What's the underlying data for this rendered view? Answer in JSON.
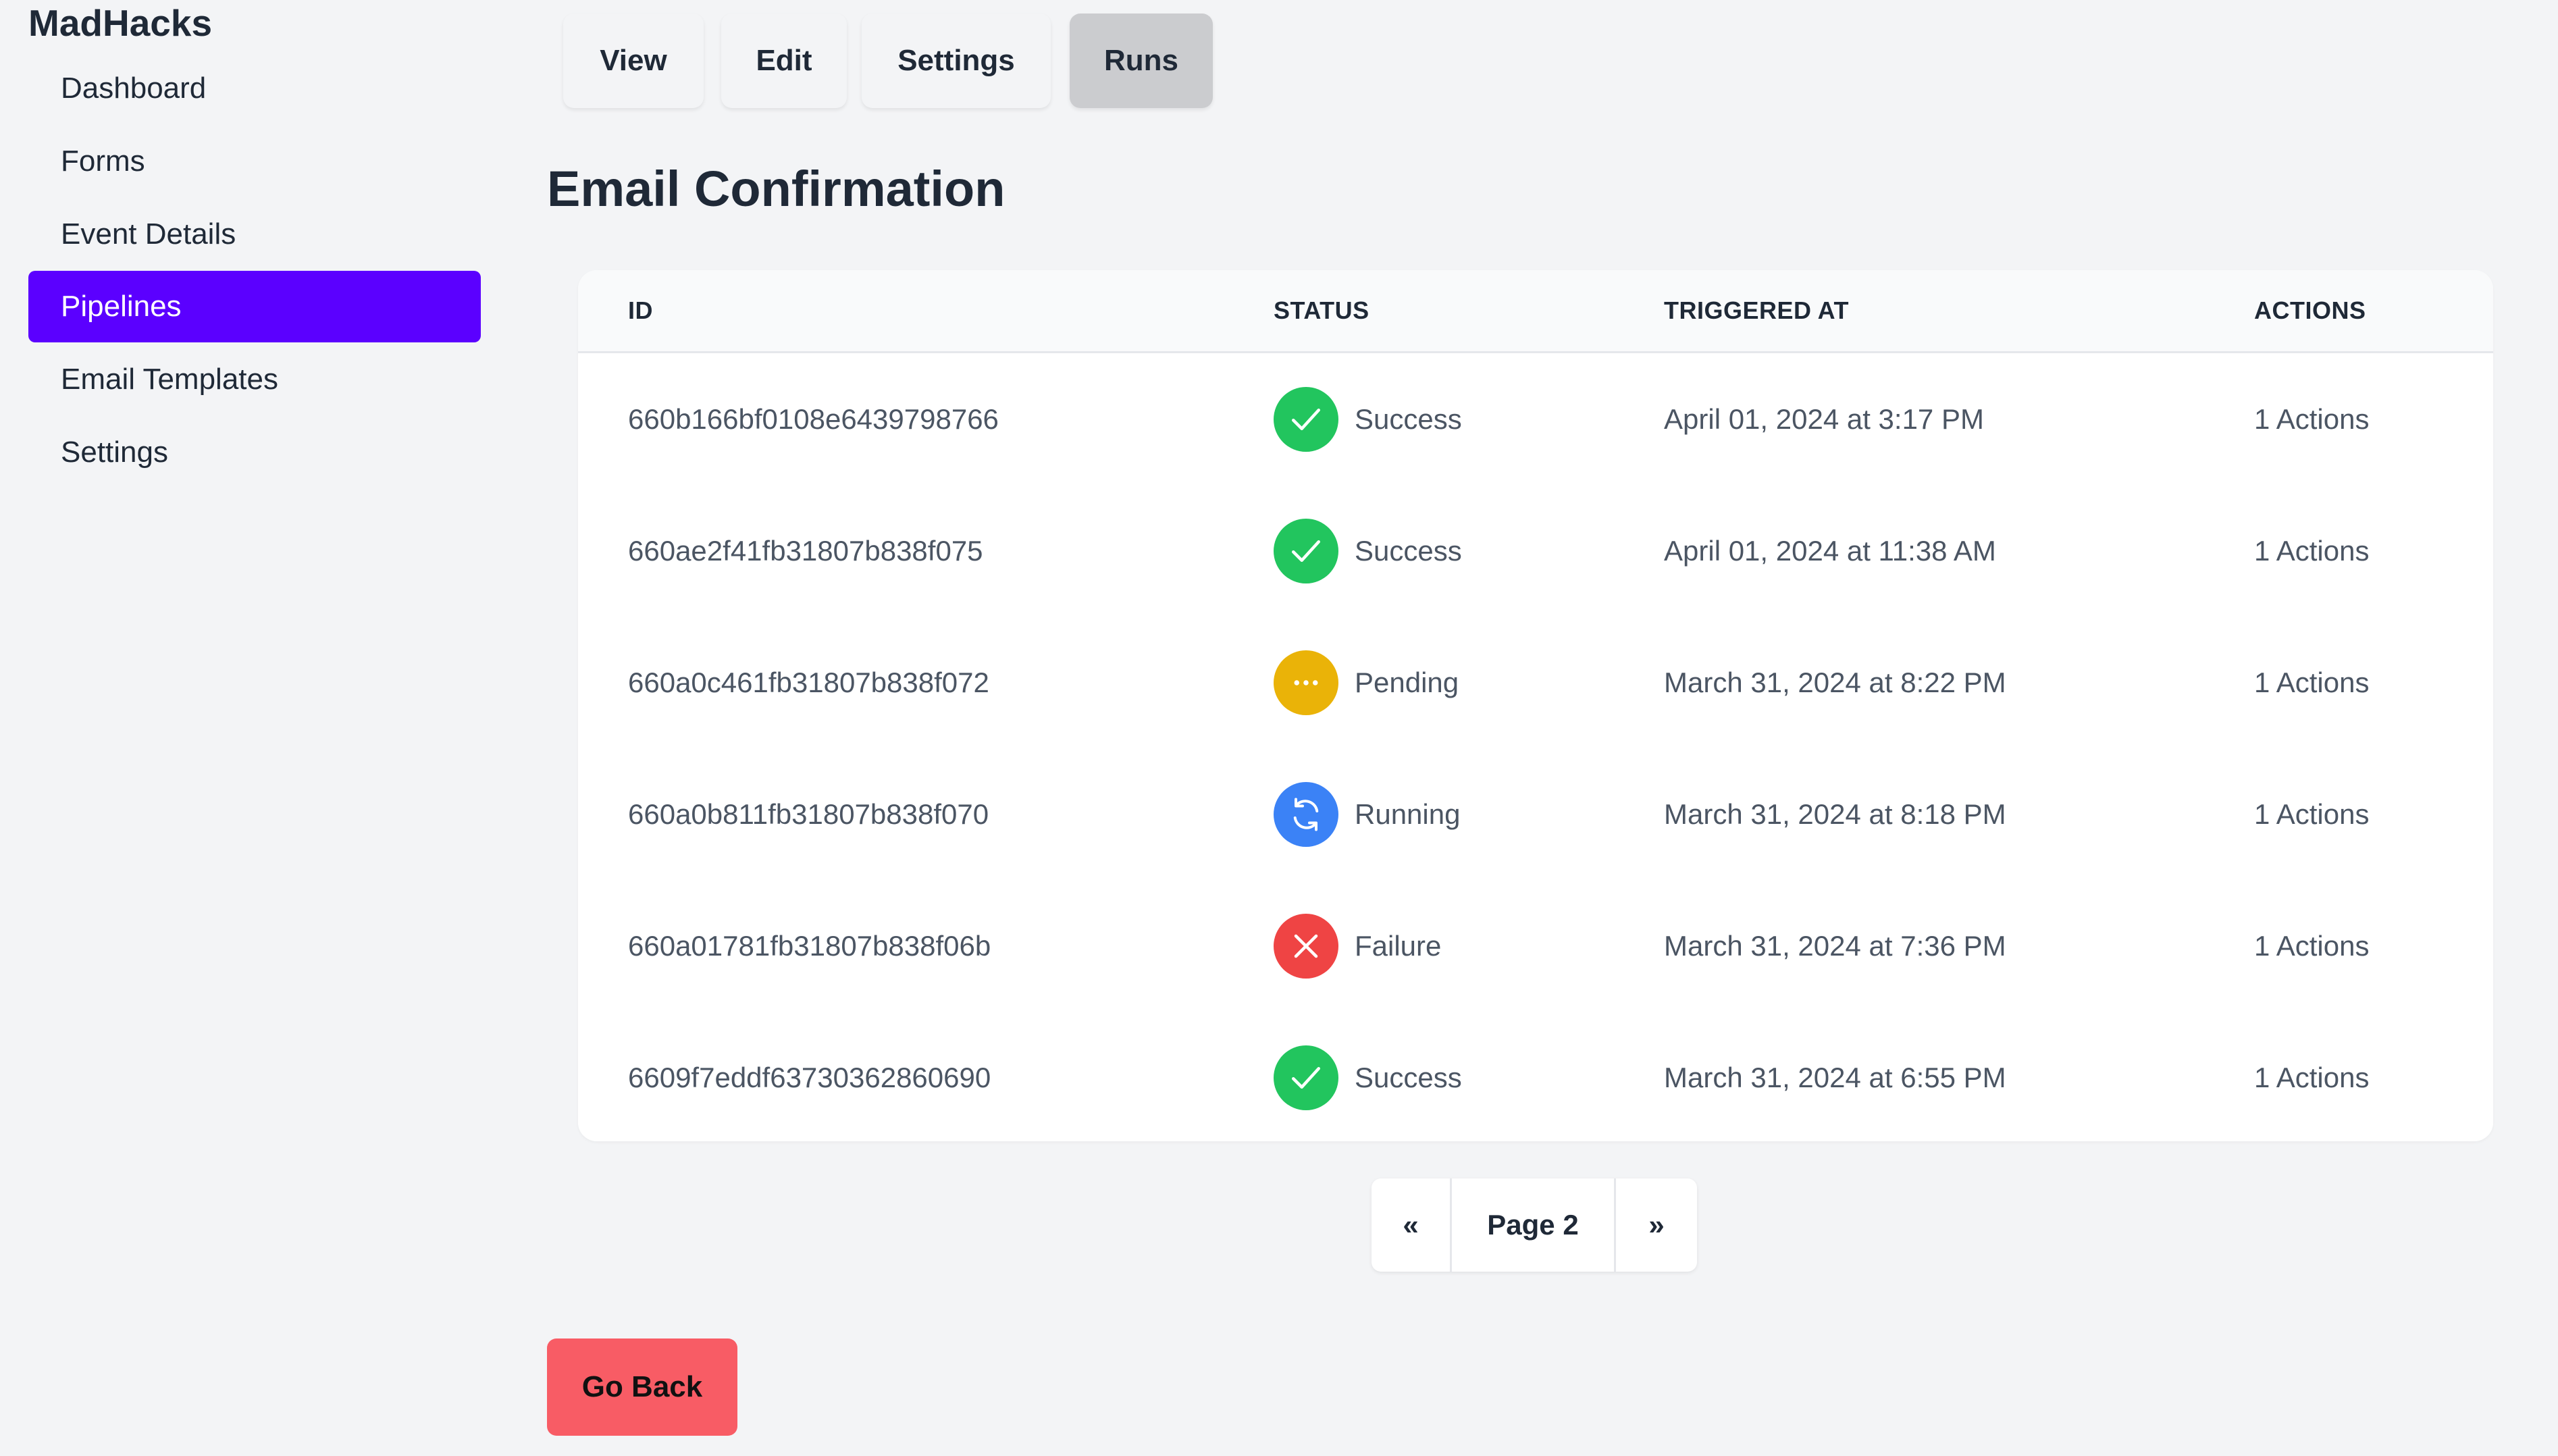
{
  "brand": "MadHacks",
  "sidebar": {
    "items": [
      {
        "label": "Dashboard"
      },
      {
        "label": "Forms"
      },
      {
        "label": "Event Details"
      },
      {
        "label": "Pipelines",
        "active": true
      },
      {
        "label": "Email Templates"
      },
      {
        "label": "Settings"
      }
    ],
    "active_color": "#5b00ff"
  },
  "tabs": [
    {
      "label": "View"
    },
    {
      "label": "Edit"
    },
    {
      "label": "Settings"
    },
    {
      "label": "Runs",
      "active": true
    }
  ],
  "page_title": "Email Confirmation",
  "table": {
    "headers": {
      "id": "ID",
      "status": "STATUS",
      "triggered_at": "TRIGGERED AT",
      "actions": "ACTIONS"
    },
    "rows": [
      {
        "id": "660b166bf0108e6439798766",
        "status": "Success",
        "status_icon": "check-icon",
        "triggered_at": "April 01, 2024 at 3:17 PM",
        "actions": "1 Actions"
      },
      {
        "id": "660ae2f41fb31807b838f075",
        "status": "Success",
        "status_icon": "check-icon",
        "triggered_at": "April 01, 2024 at 11:38 AM",
        "actions": "1 Actions"
      },
      {
        "id": "660a0c461fb31807b838f072",
        "status": "Pending",
        "status_icon": "ellipsis-icon",
        "triggered_at": "March 31, 2024 at 8:22 PM",
        "actions": "1 Actions"
      },
      {
        "id": "660a0b811fb31807b838f070",
        "status": "Running",
        "status_icon": "refresh-icon",
        "triggered_at": "March 31, 2024 at 8:18 PM",
        "actions": "1 Actions"
      },
      {
        "id": "660a01781fb31807b838f06b",
        "status": "Failure",
        "status_icon": "x-icon",
        "triggered_at": "March 31, 2024 at 7:36 PM",
        "actions": "1 Actions"
      },
      {
        "id": "6609f7eddf63730362860690",
        "status": "Success",
        "status_icon": "check-icon",
        "triggered_at": "March 31, 2024 at 6:55 PM",
        "actions": "1 Actions"
      }
    ]
  },
  "status_colors": {
    "Success": "#22c55e",
    "Pending": "#eab308",
    "Running": "#3b82f6",
    "Failure": "#ef4444"
  },
  "pagination": {
    "prev": "«",
    "label": "Page 2",
    "next": "»"
  },
  "go_back": "Go Back"
}
